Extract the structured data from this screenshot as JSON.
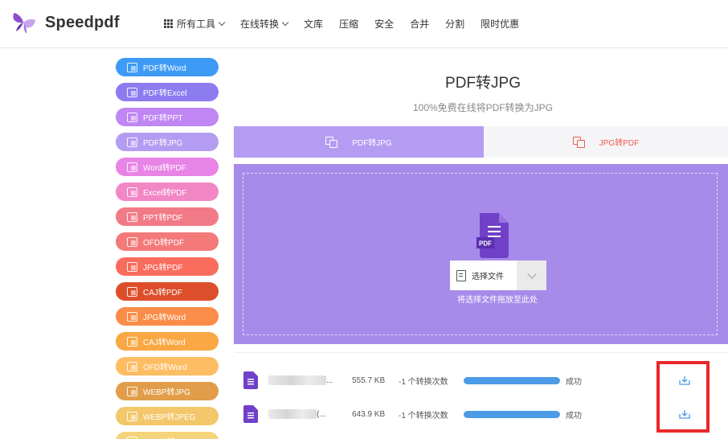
{
  "header": {
    "logo_text": "Speedpdf",
    "nav": [
      {
        "label": "所有工具",
        "icon": "grid-icon",
        "has_dropdown": true
      },
      {
        "label": "在线转换",
        "has_dropdown": true
      },
      {
        "label": "文库"
      },
      {
        "label": "压缩"
      },
      {
        "label": "安全"
      },
      {
        "label": "合并"
      },
      {
        "label": "分割"
      },
      {
        "label": "限时优惠"
      }
    ]
  },
  "sidebar": {
    "items": [
      {
        "label": "PDF转Word",
        "color": "#3d9bf5"
      },
      {
        "label": "PDF转Excel",
        "color": "#8c7cf0"
      },
      {
        "label": "PDF转PPT",
        "color": "#bf86f4"
      },
      {
        "label": "PDF转JPG",
        "color": "#b49cf3"
      },
      {
        "label": "Word转PDF",
        "color": "#e884e6"
      },
      {
        "label": "Excel转PDF",
        "color": "#f287c6"
      },
      {
        "label": "PPT转PDF",
        "color": "#f27a87"
      },
      {
        "label": "OFD转PDF",
        "color": "#f47a7a"
      },
      {
        "label": "JPG转PDF",
        "color": "#fa6c5c"
      },
      {
        "label": "CAJ转PDF",
        "color": "#dc4f2a"
      },
      {
        "label": "JPG转Word",
        "color": "#fa8d48"
      },
      {
        "label": "CAJ转Word",
        "color": "#f9a844"
      },
      {
        "label": "OFD转Word",
        "color": "#fdbd62"
      },
      {
        "label": "WEBP转JPG",
        "color": "#e19d49"
      },
      {
        "label": "WEBP转JPEG",
        "color": "#f3c76a"
      },
      {
        "label": "WEBP转PNG",
        "color": "#f4d37a"
      }
    ]
  },
  "main": {
    "title": "PDF转JPG",
    "subtitle": "100%免费在线将PDF转换为JPG",
    "tabs": [
      {
        "label": "PDF转JPG",
        "active": true
      },
      {
        "label": "JPG转PDF",
        "active": false
      }
    ],
    "dropzone": {
      "pdf_badge": "PDF",
      "select_label": "选择文件",
      "hint": "将选择文件拖放至此处"
    }
  },
  "files": [
    {
      "name_suffix": "...",
      "size": "555.7 KB",
      "count": "-1 个转换次数",
      "progress": 100,
      "status": "成功"
    },
    {
      "name_suffix": "(...",
      "size": "643.9 KB",
      "count": "-1 个转换次数",
      "progress": 100,
      "status": "成功"
    }
  ],
  "colors": {
    "accent": "#b49cf3",
    "dropzone": "#a78bea",
    "progress": "#4b9be6",
    "highlight": "#e8282a",
    "tab_inactive_text": "#ef5b4c"
  }
}
